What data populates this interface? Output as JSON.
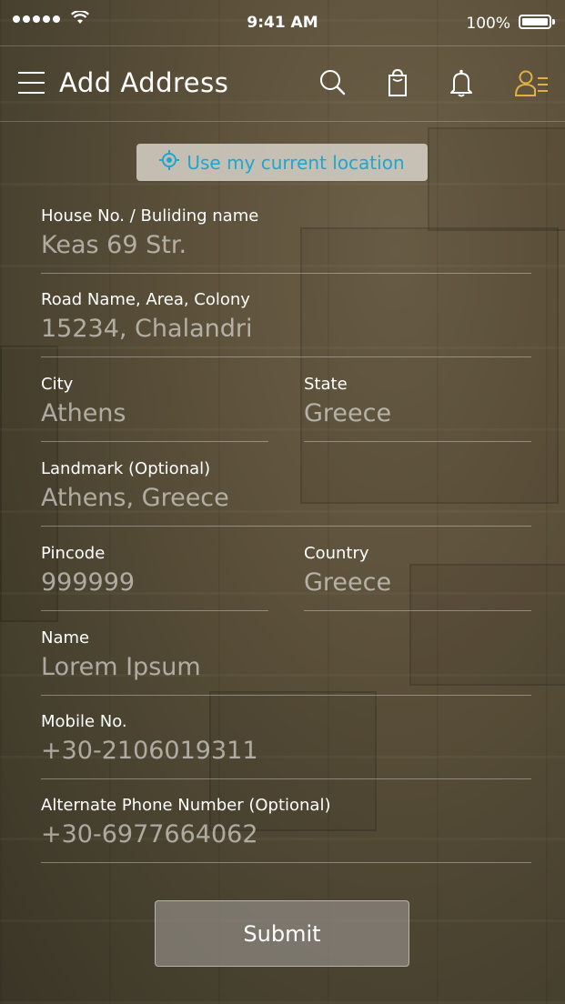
{
  "status_bar": {
    "time": "9:41 AM",
    "battery": "100%"
  },
  "header": {
    "title": "Add  Address"
  },
  "location_button": {
    "label": "Use my current location"
  },
  "form": {
    "house": {
      "label": "House No. / Buliding name",
      "value": "Keas 69 Str."
    },
    "road": {
      "label": "Road Name, Area, Colony",
      "value": "15234, Chalandri"
    },
    "city": {
      "label": "City",
      "value": "Athens"
    },
    "state": {
      "label": "State",
      "value": "Greece"
    },
    "landmark": {
      "label": "Landmark (Optional)",
      "value": "Athens, Greece"
    },
    "pincode": {
      "label": "Pincode",
      "value": "999999"
    },
    "country": {
      "label": "Country",
      "value": "Greece"
    },
    "name": {
      "label": "Name",
      "value": "Lorem Ipsum"
    },
    "mobile": {
      "label": "Mobile No.",
      "value": "+30-2106019311"
    },
    "alt_phone": {
      "label": "Alternate Phone Number (Optional)",
      "value": "+30-6977664062"
    }
  },
  "submit": {
    "label": "Submit"
  },
  "colors": {
    "accent": "#1da7cf",
    "profile_icon": "#e0b040"
  }
}
